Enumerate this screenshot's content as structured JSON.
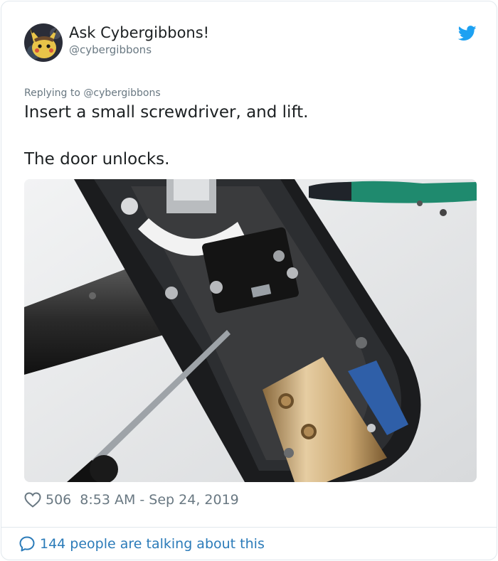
{
  "user": {
    "name": "Ask Cybergibbons!",
    "handle": "@cybergibbons"
  },
  "tweet": {
    "replying_to": "Replying to @cybergibbons",
    "line1": "Insert a small screwdriver, and lift.",
    "line2": "The door unlocks."
  },
  "meta": {
    "likes": "506",
    "timestamp": "8:53 AM - Sep 24, 2019"
  },
  "footer": {
    "talking": "144 people are talking about this"
  },
  "colors": {
    "twitter_blue": "#1da1f2",
    "link_blue": "#2b7bb9",
    "muted": "#697882"
  },
  "icons": {
    "bird": "twitter-bird-icon",
    "heart": "heart-icon",
    "bubble": "speech-bubble-icon"
  }
}
